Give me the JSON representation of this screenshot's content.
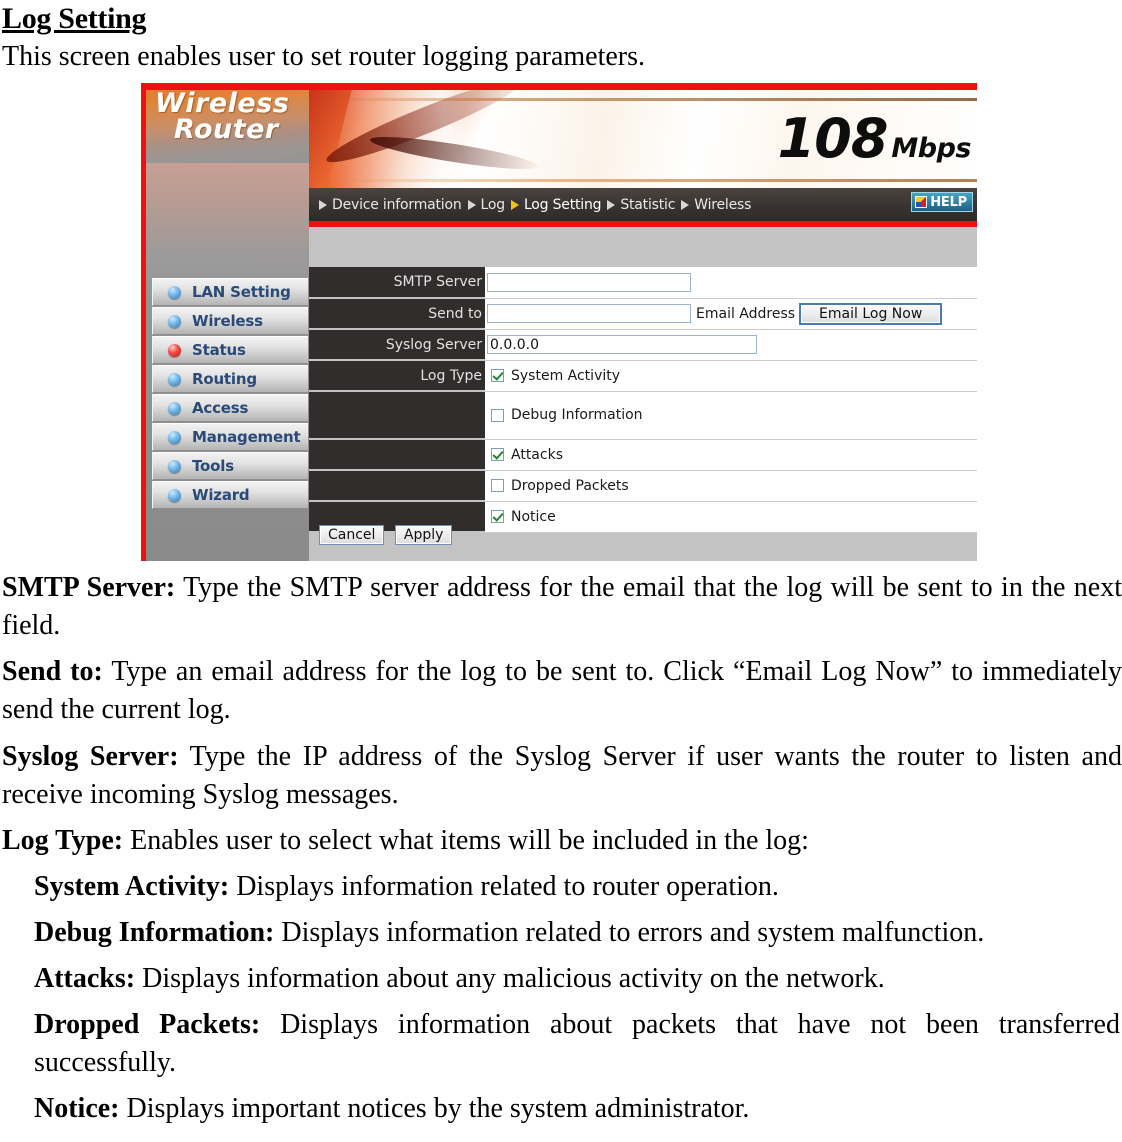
{
  "document": {
    "heading": "Log Setting",
    "intro": "This screen enables user to set router logging parameters.",
    "paragraphs": [
      {
        "term": "SMTP Server:",
        "text": " Type the SMTP server address for the email that the log will be sent to in the next field.",
        "indent": false
      },
      {
        "term": "Send to:",
        "text": " Type an email address for the log to be sent to. Click “Email Log Now” to immediately send the current log.",
        "indent": false
      },
      {
        "term": "Syslog Server:",
        "text": " Type the IP address of the Syslog Server if user wants the router to listen and receive incoming Syslog messages.",
        "indent": false
      },
      {
        "term": "Log Type:",
        "text": " Enables user to select what items will be included in the log:",
        "indent": false
      },
      {
        "term": "System Activity:",
        "text": " Displays information related to router operation.",
        "indent": true
      },
      {
        "term": "Debug Information:",
        "text": " Displays information related to errors and system malfunction.",
        "indent": true
      },
      {
        "term": "Attacks:",
        "text": " Displays information about any malicious activity on the network.",
        "indent": true
      },
      {
        "term": "Dropped Packets:",
        "text": " Displays information about packets that have not been transferred successfully.",
        "indent": true
      },
      {
        "term": "Notice:",
        "text": " Displays important notices by the system administrator.",
        "indent": true
      }
    ]
  },
  "screenshot": {
    "logo": {
      "line1": "Wireless",
      "line2": "Router"
    },
    "banner": {
      "number": "108",
      "unit": "Mbps"
    },
    "nav": {
      "items": [
        {
          "label": "Device information",
          "current": false
        },
        {
          "label": "Log",
          "current": false
        },
        {
          "label": "Log Setting",
          "current": true
        },
        {
          "label": "Statistic",
          "current": false
        },
        {
          "label": "Wireless",
          "current": false
        }
      ],
      "help_label": "HELP"
    },
    "sidebar": {
      "items": [
        {
          "label": "LAN Setting",
          "active": false
        },
        {
          "label": "Wireless",
          "active": false
        },
        {
          "label": "Status",
          "active": true
        },
        {
          "label": "Routing",
          "active": false
        },
        {
          "label": "Access",
          "active": false
        },
        {
          "label": "Management",
          "active": false
        },
        {
          "label": "Tools",
          "active": false
        },
        {
          "label": "Wizard",
          "active": false
        }
      ]
    },
    "form": {
      "smtp_label": "SMTP Server",
      "smtp_value": "",
      "sendto_label": "Send to",
      "sendto_value": "",
      "email_address_label": "Email Address",
      "email_log_now_label": "Email Log Now",
      "syslog_label": "Syslog Server",
      "syslog_value": "0.0.0.0",
      "logtype_label": "Log Type",
      "logtypes": [
        {
          "label": "System Activity",
          "checked": true
        },
        {
          "label": "Debug Information",
          "checked": false
        },
        {
          "label": "Attacks",
          "checked": true
        },
        {
          "label": "Dropped Packets",
          "checked": false
        },
        {
          "label": "Notice",
          "checked": true
        }
      ],
      "cancel_label": "Cancel",
      "apply_label": "Apply"
    },
    "colors": {
      "accent_red": "#ee1111",
      "nav_bar": "#332f2d",
      "label_cell": "#302d2c",
      "check_green": "#1d8a2e",
      "menu_text": "#2a4a78"
    }
  }
}
